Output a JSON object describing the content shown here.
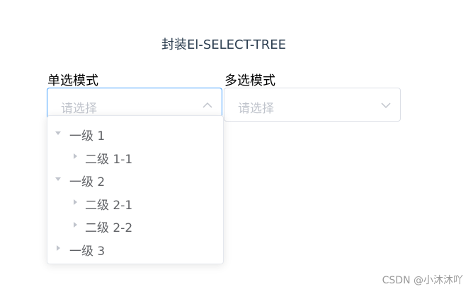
{
  "title": "封装El-SELECT-TREE",
  "single": {
    "label": "单选模式",
    "placeholder": "请选择",
    "open": true
  },
  "multiple": {
    "label": "多选模式",
    "placeholder": "请选择",
    "open": false
  },
  "tree": [
    {
      "label": "一级 1",
      "level": 1,
      "expanded": true,
      "icon": "caret-down-icon"
    },
    {
      "label": "二级 1-1",
      "level": 2,
      "expanded": false,
      "icon": "caret-right-icon"
    },
    {
      "label": "一级 2",
      "level": 1,
      "expanded": true,
      "icon": "caret-down-icon"
    },
    {
      "label": "二级 2-1",
      "level": 2,
      "expanded": false,
      "icon": "caret-right-icon"
    },
    {
      "label": "二级 2-2",
      "level": 2,
      "expanded": false,
      "icon": "caret-right-icon"
    },
    {
      "label": "一级 3",
      "level": 1,
      "expanded": false,
      "icon": "caret-right-icon"
    }
  ],
  "watermark": "CSDN @小沐沐吖",
  "colors": {
    "focus_border": "#409eff",
    "border": "#dcdfe6",
    "placeholder": "#c0c4cc",
    "tree_text": "#606266",
    "caret": "#c0c4cc"
  }
}
